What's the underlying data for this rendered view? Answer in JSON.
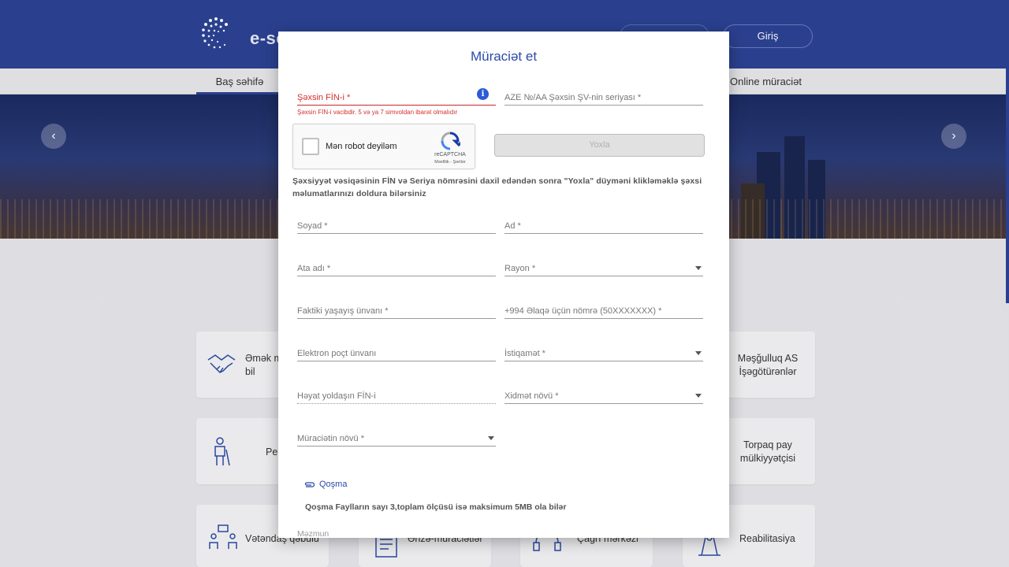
{
  "site": {
    "logo_text": "e-so",
    "login_label": "Giriş",
    "nav_home": "Baş səhifə",
    "nav_online": "Online müraciət",
    "prev_arrow": "‹",
    "next_arrow": "›"
  },
  "cards": {
    "card1_label": "Əmək m\nbil",
    "card2_label": "Məşğulluq AS\nİşəgötürənlər",
    "card3_label": "Pe",
    "card4_label": "Torpaq pay\nmülkiyyətçisi",
    "card5_label": "Vətəndaş qəbulu",
    "card6_label": "Ərizə-müraciətlər",
    "card7_label": "Çağrı mərkəzi",
    "card8_label": "Reabilitasiya"
  },
  "modal": {
    "title": "Müraciət et",
    "fin_label": "Şəxsin FİN-i *",
    "fin_error": "Şəxsin FİN-i vacibdir. 5 və ya 7 simvoldan ibarət olmalıdır",
    "fin_info_icon": "i",
    "series_label": "AZE №/AA  Şəxsin ŞV-nin seriyası *",
    "captcha_text": "Mən robot deyiləm",
    "captcha_brand": "reCAPTCHA",
    "captcha_links": "Məxfilik - Şərtlər",
    "check_button": "Yoxla",
    "hint": "Şəxsiyyət vəsiqəsinin FİN və Seriya nömrəsini daxil edəndən sonra \"Yoxla\" düyməni klikləməklə şəxsi məlumatlarınızı doldura bilərsiniz",
    "fields": {
      "surname": "Soyad *",
      "name": "Ad *",
      "father_name": "Ata adı *",
      "region": "Rayon *",
      "address": "Faktiki yaşayış ünvanı *",
      "phone": "+994  Əlaqə üçün nömrə (50XXXXXXX) *",
      "email": "Elektron poçt ünvanı",
      "direction": "İstiqamət *",
      "spouse_fin": "Həyat yoldaşın FİN-i",
      "service_type": "Xidmət növü *",
      "request_type": "Müraciətin növü *"
    },
    "attach_label": "Qoşma",
    "attach_note": "Qoşma Faylların sayı 3,toplam ölçüsü isə maksimum 5MB ola bilər",
    "content_label": "Məzmun"
  }
}
